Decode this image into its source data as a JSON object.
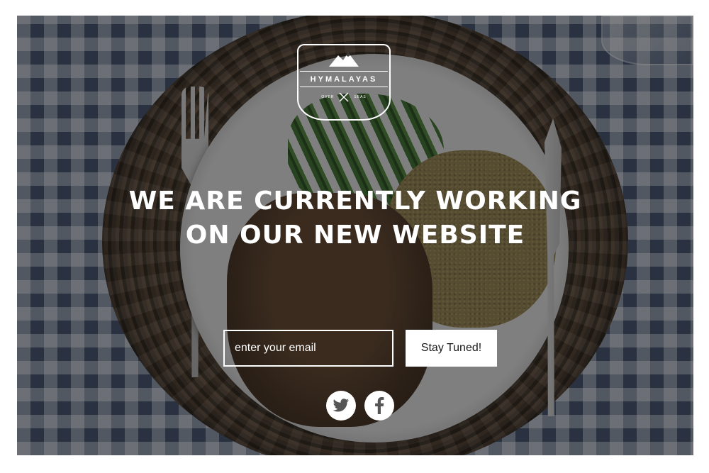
{
  "logo": {
    "brand": "HYMALAYAS",
    "left_text": "OVER",
    "right_text": "SEAS"
  },
  "headline": {
    "line1": "WE ARE CURRENTLY WORKING",
    "line2": "ON OUR NEW WEBSITE"
  },
  "signup": {
    "email_placeholder": "enter your email",
    "button_label": "Stay Tuned!"
  },
  "social": [
    {
      "icon": "twitter-icon"
    },
    {
      "icon": "facebook-icon"
    }
  ],
  "colors": {
    "text": "#ffffff",
    "button_bg": "#ffffff",
    "button_text": "#1a1a1a",
    "social_icon": "#555555"
  }
}
